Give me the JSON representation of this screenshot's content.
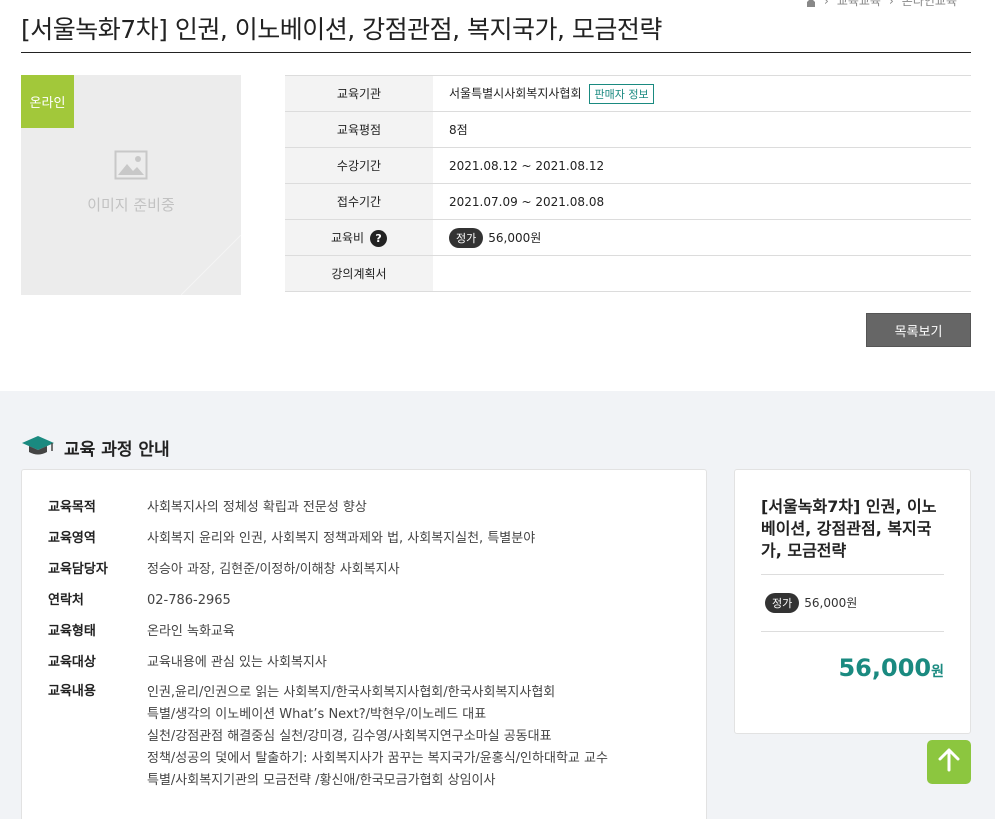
{
  "breadcrumb": {
    "items": [
      "교육교육",
      "온라인교육"
    ]
  },
  "page_title": "[서울녹화7차] 인권, 이노베이션, 강점관점, 복지국가, 모금전략",
  "thumbnail": {
    "badge": "온라인",
    "placeholder": "이미지 준비중"
  },
  "info": {
    "institution_label": "교육기관",
    "institution_value": "서울특별시사회복지사협회",
    "seller_button": "판매자 정보",
    "points_label": "교육평점",
    "points_value": "8점",
    "period_label": "수강기간",
    "period_value": "2021.08.12 ~ 2021.08.12",
    "apply_label": "접수기간",
    "apply_value": "2021.07.09 ~ 2021.08.08",
    "fee_label": "교육비",
    "fee_badge": "정가",
    "fee_value": "56,000원",
    "plan_label": "강의계획서",
    "plan_value": ""
  },
  "list_button": "목록보기",
  "section_title": "교육 과정 안내",
  "details": {
    "purpose_label": "교육목적",
    "purpose_value": "사회복지사의 정체성 확립과 전문성 향상",
    "area_label": "교육영역",
    "area_value": "사회복지 윤리와 인권, 사회복지 정책과제와 법, 사회복지실천, 특별분야",
    "manager_label": "교육담당자",
    "manager_value": "정승아 과장, 김현준/이정하/이해창 사회복지사",
    "contact_label": "연락처",
    "contact_value": "02-786-2965",
    "type_label": "교육형태",
    "type_value": "온라인 녹화교육",
    "target_label": "교육대상",
    "target_value": "교육내용에 관심 있는 사회복지사",
    "content_label": "교육내용",
    "content_lines": [
      "인권,윤리/인권으로 읽는 사회복지/한국사회복지사협회/한국사회복지사협회",
      "특별/생각의 이노베이션 What’s Next?/박현우/이노레드 대표",
      "실천/강점관점 해결중심 실천/강미경, 김수영/사회복지연구소마실 공동대표",
      "정책/성공의 덫에서 탈출하기: 사회복지사가 꿈꾸는 복지국가/윤홍식/인하대학교 교수",
      "특별/사회복지기관의 모금전략 /황신애/한국모금가협회 상임이사"
    ]
  },
  "side": {
    "title": "[서울녹화7차] 인권, 이노베이션, 강점관점, 복지국가, 모금전략",
    "price_badge": "정가",
    "price_value": "56,000원",
    "total_amount": "56,000",
    "total_unit": "원"
  },
  "colors": {
    "accent_green": "#8cc63f",
    "teal": "#1a8a80",
    "badge_green": "#a2c83a"
  },
  "icons": [
    "home-icon",
    "image-placeholder-icon",
    "help-icon",
    "graduation-cap-icon",
    "arrow-up-icon"
  ]
}
